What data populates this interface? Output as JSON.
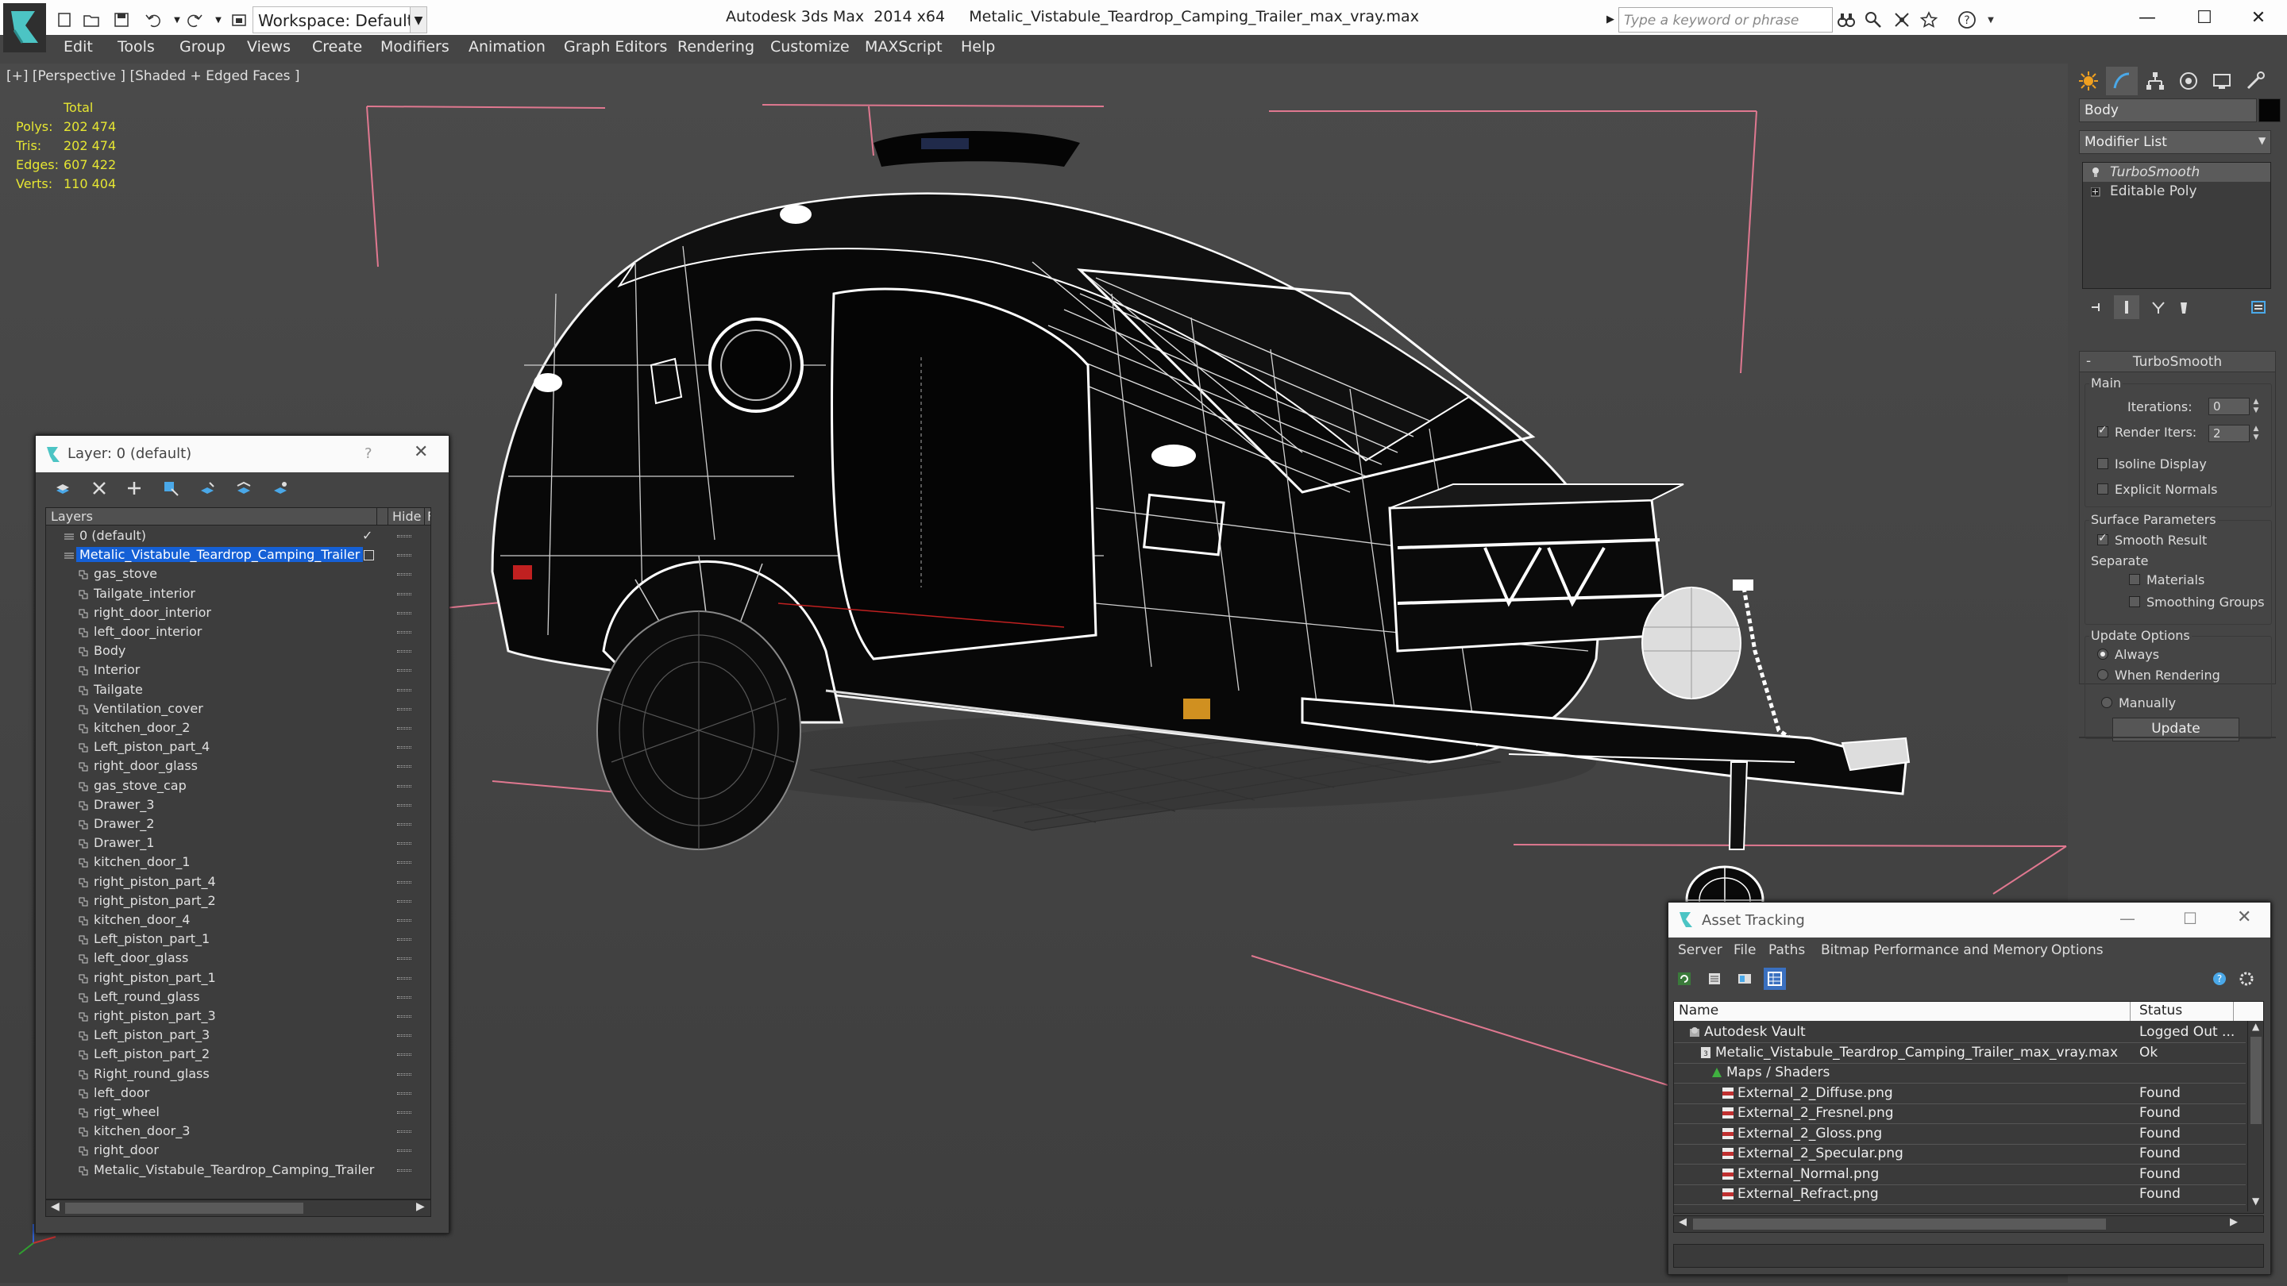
{
  "titlebar": {
    "title": "Autodesk 3ds Max  2014 x64     Metalic_Vistabule_Teardrop_Camping_Trailer_max_vray.max",
    "workspace": "Workspace: Default",
    "search_placeholder": "Type a keyword or phrase"
  },
  "menubar": [
    "Edit",
    "Tools",
    "Group",
    "Views",
    "Create",
    "Modifiers",
    "Animation",
    "Graph Editors",
    "Rendering",
    "Customize",
    "MAXScript",
    "Help"
  ],
  "viewport": {
    "label": "[+] [Perspective ] [Shaded + Edged Faces ]",
    "stats": {
      "header": "Total",
      "rows": [
        {
          "label": "Polys:",
          "value": "202 474"
        },
        {
          "label": "Tris:",
          "value": "202 474"
        },
        {
          "label": "Edges:",
          "value": "607 422"
        },
        {
          "label": "Verts:",
          "value": "110 404"
        }
      ]
    }
  },
  "command_panel": {
    "object_name": "Body",
    "modifier_list": "Modifier List",
    "stack": [
      "TurboSmooth",
      "Editable Poly"
    ],
    "turbosmooth": {
      "title": "TurboSmooth",
      "main_label": "Main",
      "iterations_label": "Iterations:",
      "iterations_value": "0",
      "render_iters_label": "Render Iters:",
      "render_iters_value": "2",
      "isoline": "Isoline Display",
      "explicit_normals": "Explicit Normals",
      "surface_params": "Surface Parameters",
      "smooth_result": "Smooth Result",
      "separate": "Separate",
      "materials": "Materials",
      "smoothing_groups": "Smoothing Groups",
      "update_options": "Update Options",
      "always": "Always",
      "when_rendering": "When Rendering",
      "manually": "Manually",
      "update_button": "Update"
    }
  },
  "layer_dialog": {
    "title": "Layer: 0 (default)",
    "help": "?",
    "col_layers": "Layers",
    "col_hide": "Hide",
    "col_f": "F",
    "layers": [
      {
        "name": "0 (default)",
        "indent": 0
      },
      {
        "name": "Metalic_Vistabule_Teardrop_Camping_Trailer",
        "indent": 0,
        "selected": true
      },
      {
        "name": "gas_stove",
        "indent": 1
      },
      {
        "name": "Tailgate_interior",
        "indent": 1
      },
      {
        "name": "right_door_interior",
        "indent": 1
      },
      {
        "name": "left_door_interior",
        "indent": 1
      },
      {
        "name": "Body",
        "indent": 1
      },
      {
        "name": "Interior",
        "indent": 1
      },
      {
        "name": "Tailgate",
        "indent": 1
      },
      {
        "name": "Ventilation_cover",
        "indent": 1
      },
      {
        "name": "kitchen_door_2",
        "indent": 1
      },
      {
        "name": "Left_piston_part_4",
        "indent": 1
      },
      {
        "name": "right_door_glass",
        "indent": 1
      },
      {
        "name": "gas_stove_cap",
        "indent": 1
      },
      {
        "name": "Drawer_3",
        "indent": 1
      },
      {
        "name": "Drawer_2",
        "indent": 1
      },
      {
        "name": "Drawer_1",
        "indent": 1
      },
      {
        "name": "kitchen_door_1",
        "indent": 1
      },
      {
        "name": "right_piston_part_4",
        "indent": 1
      },
      {
        "name": "right_piston_part_2",
        "indent": 1
      },
      {
        "name": "kitchen_door_4",
        "indent": 1
      },
      {
        "name": "Left_piston_part_1",
        "indent": 1
      },
      {
        "name": "left_door_glass",
        "indent": 1
      },
      {
        "name": "right_piston_part_1",
        "indent": 1
      },
      {
        "name": "Left_round_glass",
        "indent": 1
      },
      {
        "name": "right_piston_part_3",
        "indent": 1
      },
      {
        "name": "Left_piston_part_3",
        "indent": 1
      },
      {
        "name": "Left_piston_part_2",
        "indent": 1
      },
      {
        "name": "Right_round_glass",
        "indent": 1
      },
      {
        "name": "left_door",
        "indent": 1
      },
      {
        "name": "rigt_wheel",
        "indent": 1
      },
      {
        "name": "kitchen_door_3",
        "indent": 1
      },
      {
        "name": "right_door",
        "indent": 1
      },
      {
        "name": "Metalic_Vistabule_Teardrop_Camping_Trailer",
        "indent": 1
      }
    ]
  },
  "asset_dialog": {
    "title": "Asset Tracking",
    "menu": [
      "Server",
      "File",
      "Paths",
      "Bitmap Performance and Memory",
      "Options"
    ],
    "col_name": "Name",
    "col_status": "Status",
    "rows": [
      {
        "name": "Autodesk Vault",
        "status": "Logged Out ...",
        "indent": 0,
        "icon": "vault-icon"
      },
      {
        "name": "Metalic_Vistabule_Teardrop_Camping_Trailer_max_vray.max",
        "status": "Ok",
        "indent": 1,
        "icon": "max-file-icon"
      },
      {
        "name": "Maps / Shaders",
        "status": "",
        "indent": 2,
        "icon": "maps-icon"
      },
      {
        "name": "External_2_Diffuse.png",
        "status": "Found",
        "indent": 3,
        "icon": "png-icon"
      },
      {
        "name": "External_2_Fresnel.png",
        "status": "Found",
        "indent": 3,
        "icon": "png-icon"
      },
      {
        "name": "External_2_Gloss.png",
        "status": "Found",
        "indent": 3,
        "icon": "png-icon"
      },
      {
        "name": "External_2_Specular.png",
        "status": "Found",
        "indent": 3,
        "icon": "png-icon"
      },
      {
        "name": "External_Normal.png",
        "status": "Found",
        "indent": 3,
        "icon": "png-icon"
      },
      {
        "name": "External_Refract.png",
        "status": "Found",
        "indent": 3,
        "icon": "png-icon"
      }
    ]
  },
  "colors": {
    "selection": "#1560d6",
    "stats_text": "#e6e632",
    "wire": "#ffffff",
    "guide": "#e07890"
  }
}
